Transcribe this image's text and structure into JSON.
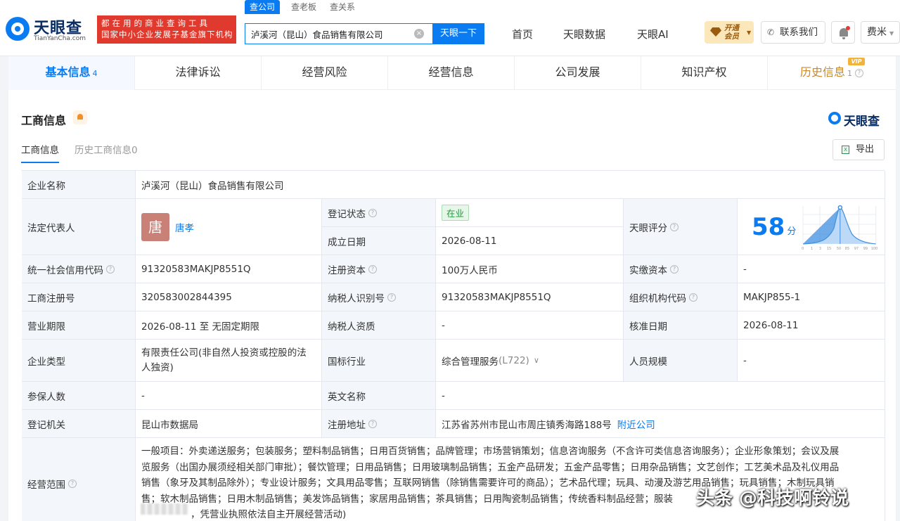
{
  "header": {
    "logo_text": "天眼查",
    "logo_sub": "TianYanCha.com",
    "promo_line1": "都在用的商业查询工具",
    "promo_line2": "国家中小企业发展子基金旗下机构",
    "search_tabs": [
      "查公司",
      "查老板",
      "查关系"
    ],
    "search_value": "泸溪河（昆山）食品销售有限公司",
    "search_button": "天眼一下",
    "nav": [
      "首页",
      "天眼数据",
      "天眼AI"
    ],
    "vip_label": "开通会员",
    "contact_label": "联系我们",
    "user_name": "费米"
  },
  "tabs": [
    {
      "label": "基本信息",
      "count": "4"
    },
    {
      "label": "法律诉讼",
      "count": ""
    },
    {
      "label": "经营风险",
      "count": ""
    },
    {
      "label": "经营信息",
      "count": ""
    },
    {
      "label": "公司发展",
      "count": ""
    },
    {
      "label": "知识产权",
      "count": ""
    },
    {
      "label": "历史信息",
      "count": "1",
      "tag": "VIP"
    }
  ],
  "section": {
    "title": "工商信息",
    "brand": "天眼查",
    "subtab_active": "工商信息",
    "subtab_history": "历史工商信息0",
    "export_label": "导出",
    "export_icon": "X"
  },
  "info": {
    "company_name_label": "企业名称",
    "company_name": "泸溪河（昆山）食品销售有限公司",
    "legal_rep_label": "法定代表人",
    "legal_rep_avatar": "唐",
    "legal_rep_name": "唐孝",
    "reg_status_label": "登记状态",
    "reg_status": "在业",
    "est_date_label": "成立日期",
    "est_date": "2026-08-11",
    "score_label": "天眼评分",
    "score": "58",
    "score_unit": "分",
    "score_axis": [
      "0",
      "1",
      "3",
      "15",
      "50",
      "85",
      "97",
      "99",
      "100"
    ],
    "credit_code_label": "统一社会信用代码",
    "credit_code": "91320583MAKJP8551Q",
    "reg_capital_label": "注册资本",
    "reg_capital": "100万人民币",
    "paid_capital_label": "实缴资本",
    "paid_capital": "-",
    "biz_reg_no_label": "工商注册号",
    "biz_reg_no": "320583002844395",
    "taxpayer_id_label": "纳税人识别号",
    "taxpayer_id": "91320583MAKJP8551Q",
    "org_code_label": "组织机构代码",
    "org_code": "MAKJP855-1",
    "term_label": "营业期限",
    "term": "2026-08-11 至 无固定期限",
    "taxpayer_qual_label": "纳税人资质",
    "taxpayer_qual": "-",
    "approve_date_label": "核准日期",
    "approve_date": "2026-08-11",
    "company_type_label": "企业类型",
    "company_type_1": "有限责任公司(非自然人投资或控股的法",
    "company_type_2": "人独资)",
    "industry_label": "国标行业",
    "industry": "综合管理服务",
    "industry_code": "(L722)",
    "staff_size_label": "人员规模",
    "staff_size": "-",
    "insured_label": "参保人数",
    "insured": "-",
    "english_name_label": "英文名称",
    "english_name": "-",
    "reg_authority_label": "登记机关",
    "reg_authority": "昆山市数据局",
    "address_label": "注册地址",
    "address": "江苏省苏州市昆山市周庄镇秀海路188号",
    "nearby_link": "附近公司",
    "scope_label": "经营范围",
    "scope_lines": [
      "一般项目：外卖递送服务；包装服务；塑料制品销售；日用百货销售；品牌管理；市场营销策划；信息咨询服务（不含许可类信息咨询服务）；企业形象策划；会议及展",
      "览服务（出国办展须经相关部门审批）；餐饮管理；日用品销售；日用玻璃制品销售；五金产品研发；五金产品零售；日用杂品销售；文艺创作；工艺美术品及礼仪用品",
      "销售（象牙及其制品除外）；专业设计服务；文具用品零售；互联网销售（除销售需要许可的商品）；艺术品代理；玩具、动漫及游艺用品销售；玩具销售；木制玩具销",
      "售；软木制品销售；日用木制品销售；美发饰品销售；家居用品销售；茶具销售；日用陶瓷制品销售；传统香料制品经营；服装",
      "，凭营业执照依法自主开展经营活动)"
    ]
  },
  "watermark": "头条 @科技啊铃说"
}
